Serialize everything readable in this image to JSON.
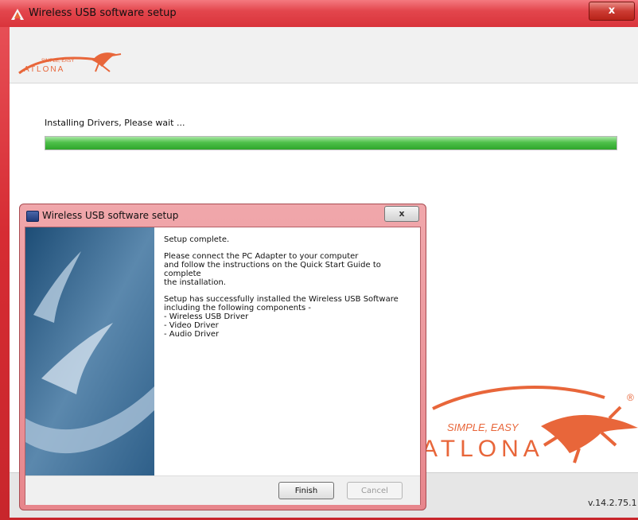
{
  "main_window": {
    "title": "Wireless USB software setup",
    "close_glyph": "x",
    "logo_tagline": "SIMPLE, EASY",
    "logo_brand": "ATLONA",
    "status_text": "Installing Drivers, Please wait ...",
    "progress": 1.0,
    "big_logo": {
      "tagline": "SIMPLE, EASY",
      "brand": "ATLONA",
      "registered": "®"
    },
    "version": "v.14.2.75.1"
  },
  "dialog": {
    "title": "Wireless USB software setup",
    "close_glyph": "x",
    "paragraph_1": "Setup complete.",
    "paragraph_2": "Please connect the PC Adapter to your computer\nand follow the instructions on the Quick Start Guide to complete\nthe installation.",
    "paragraph_3": "Setup has successfully installed the Wireless USB Software\nincluding the following components -\n- Wireless USB Driver\n- Video Driver\n- Audio Driver",
    "finish_label": "Finish",
    "cancel_label": "Cancel"
  },
  "icons": [
    "atlona-app-icon",
    "close-icon",
    "installer-app-icon",
    "gecko-logo-icon"
  ],
  "colors": {
    "accent": "#d62c33",
    "progress": "#3cb43a",
    "logo_orange": "#e8663a"
  }
}
